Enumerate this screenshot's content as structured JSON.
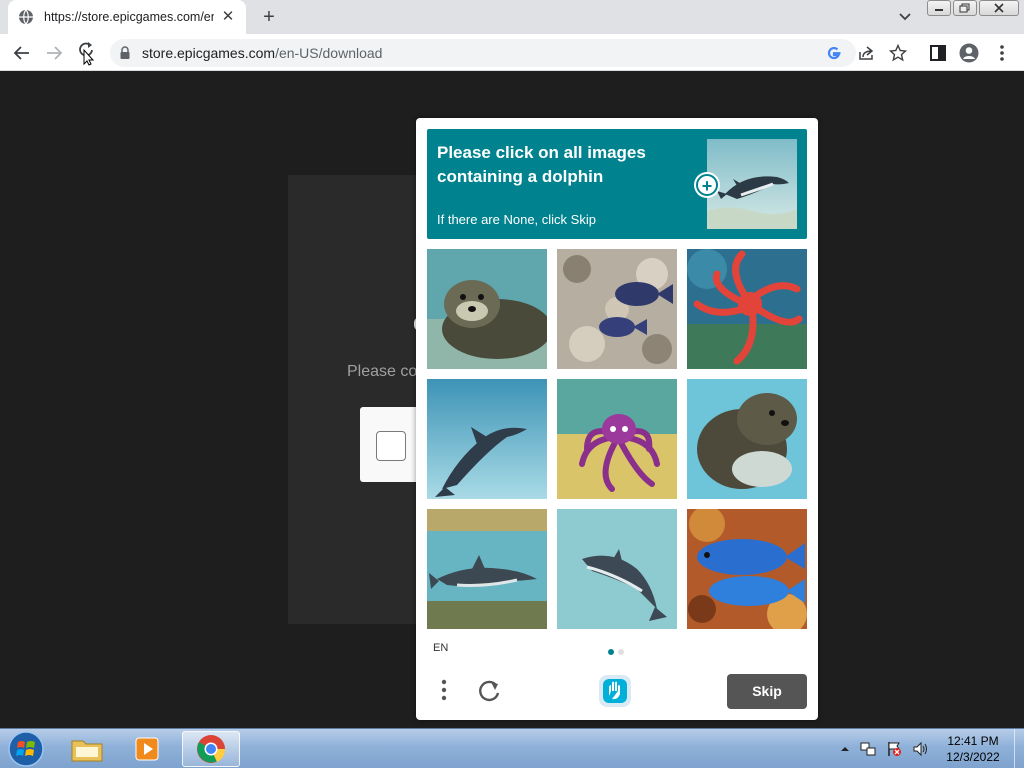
{
  "browser": {
    "tab_title": "https://store.epicgames.com/en-",
    "new_tab_symbol": "+",
    "url_host": "store.epicgames.com",
    "url_path": "/en-US/download"
  },
  "page": {
    "message": "Please co"
  },
  "captcha": {
    "prompt": "Please click on all images containing a dolphin",
    "subprompt": "If there are None, click Skip",
    "language": "EN",
    "skip_label": "Skip",
    "tiles": [
      {
        "subject": "seal",
        "has_dolphin": false
      },
      {
        "subject": "fish-on-coral",
        "has_dolphin": false
      },
      {
        "subject": "octopus-red",
        "has_dolphin": false
      },
      {
        "subject": "dolphin",
        "has_dolphin": true
      },
      {
        "subject": "octopus-purple",
        "has_dolphin": false
      },
      {
        "subject": "seal",
        "has_dolphin": false
      },
      {
        "subject": "dolphin",
        "has_dolphin": true
      },
      {
        "subject": "dolphin",
        "has_dolphin": true
      },
      {
        "subject": "blue-fish",
        "has_dolphin": false
      }
    ],
    "accent_color": "#00838f",
    "page_indicator": {
      "current": 1,
      "total": 2
    }
  },
  "taskbar": {
    "time": "12:41 PM",
    "date": "12/3/2022",
    "apps": [
      "file-explorer",
      "media-player",
      "chrome"
    ]
  }
}
